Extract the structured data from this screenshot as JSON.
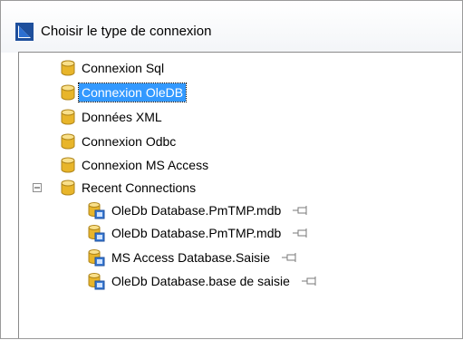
{
  "window": {
    "title": "Choisir le type de connexion",
    "title_icon": "app-icon"
  },
  "tree": {
    "items": [
      {
        "label": "Connexion Sql",
        "icon": "database-icon"
      },
      {
        "label": "Connexion OleDB",
        "icon": "database-icon",
        "selected": true
      },
      {
        "label": "Données XML",
        "icon": "database-icon"
      },
      {
        "label": "Connexion Odbc",
        "icon": "database-icon"
      },
      {
        "label": "Connexion MS Access",
        "icon": "database-icon"
      },
      {
        "label": "Recent Connections",
        "icon": "database-icon",
        "expanded": true
      }
    ],
    "recent": [
      {
        "label": "OleDb Database.PmTMP.mdb",
        "icon": "recent-connection-icon",
        "pin": "pin-icon"
      },
      {
        "label": "OleDb Database.PmTMP.mdb",
        "icon": "recent-connection-icon",
        "pin": "pin-icon"
      },
      {
        "label": "MS Access Database.Saisie",
        "icon": "recent-connection-icon",
        "pin": "pin-icon"
      },
      {
        "label": "OleDb Database.base de saisie",
        "icon": "recent-connection-icon",
        "pin": "pin-icon"
      }
    ]
  },
  "colors": {
    "selection": "#3399ff",
    "db_icon": "#e8b52a",
    "connector": "#a0a0a0"
  }
}
